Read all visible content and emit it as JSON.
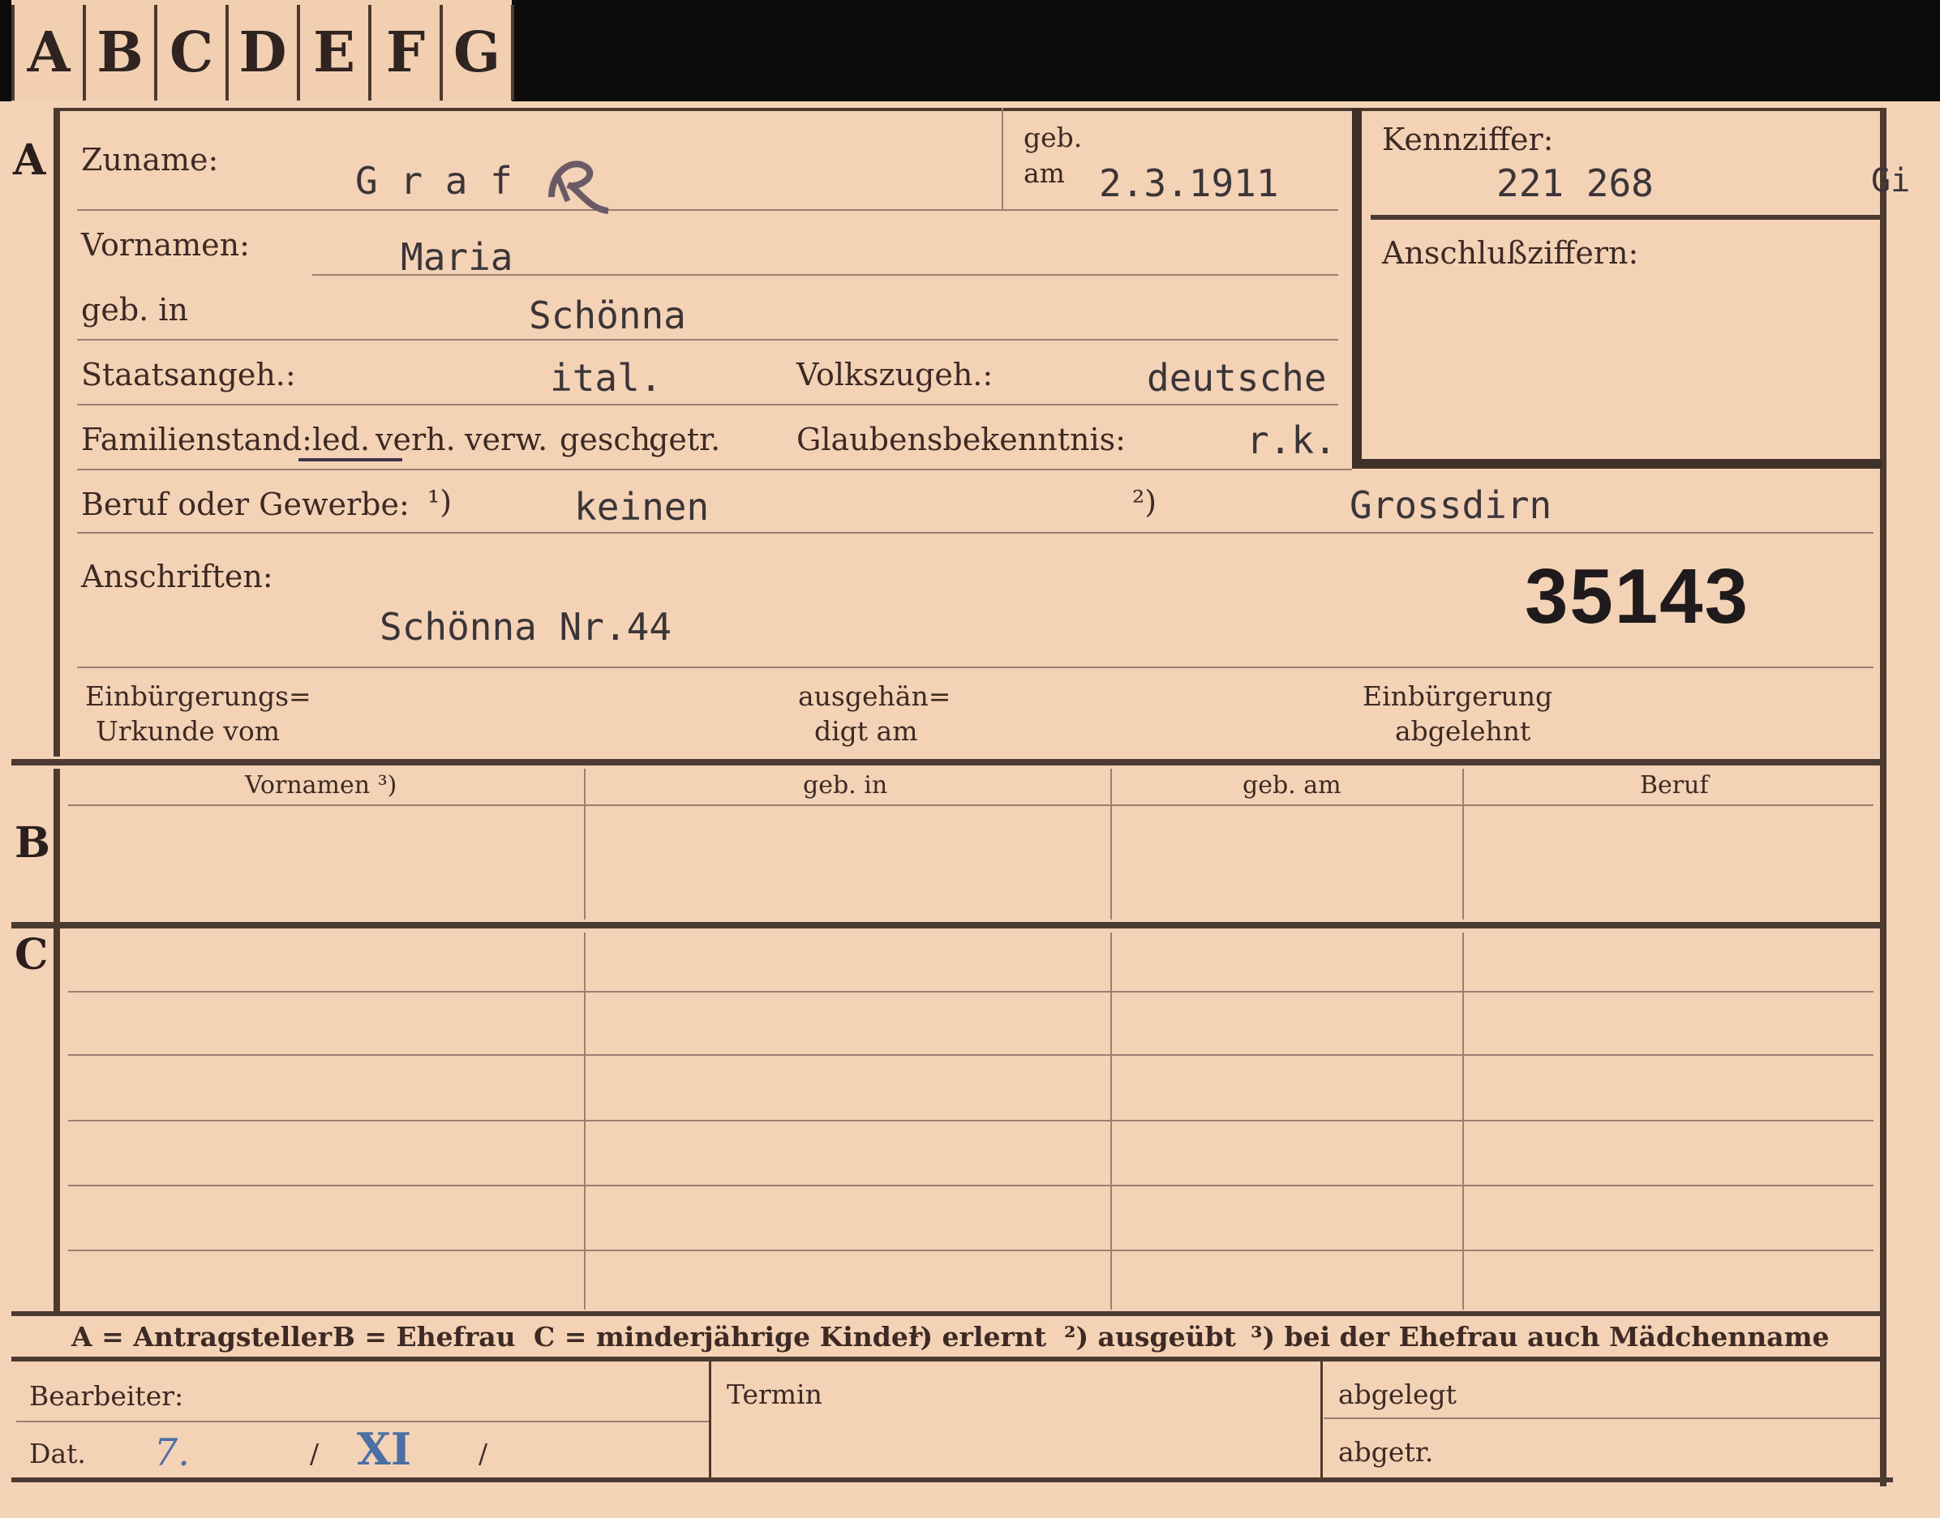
{
  "tabs": [
    "A",
    "B",
    "C",
    "D",
    "E",
    "F",
    "G"
  ],
  "sections": {
    "a": "A",
    "b": "B",
    "c": "C"
  },
  "applicant": {
    "surname_label": "Zuname:",
    "surname": "G r a f",
    "born_label1": "geb.",
    "born_label2": "am",
    "birth_date": "2.3.1911",
    "firstname_label": "Vornamen:",
    "firstname": "Maria",
    "birthplace_label": "geb. in",
    "birthplace": "Schönna",
    "citizenship_label": "Staatsangeh.:",
    "citizenship": "ital.",
    "ethnicity_label": "Volkszugeh.:",
    "ethnicity": "deutsche",
    "marital_label": "Familienstand:",
    "marital_options": [
      "led.",
      "verh.",
      "verw.",
      "gesch.",
      "getr."
    ],
    "marital_selected": "led.",
    "religion_label": "Glaubensbekenntnis:",
    "religion": "r.k.",
    "job_label": "Beruf oder Gewerbe:",
    "fn1": "¹)",
    "job_learned": "keinen",
    "fn2": "²)",
    "job_practised": "Grossdirn",
    "address_label": "Anschriften:",
    "address": "Schönna Nr.44",
    "case_number": "35143",
    "natur_cert_label1": "Einbürgerungs=",
    "natur_cert_label2": "Urkunde vom",
    "handed_label1": "ausgehän=",
    "handed_label2": "digt am",
    "natur_denied_label1": "Einbürgerung",
    "natur_denied_label2": "abgelehnt"
  },
  "reference": {
    "label": "Kennziffer:",
    "value": "221 268",
    "side_mark": "Gi",
    "connection_label": "Anschlußziffern:"
  },
  "family_table": {
    "headers": [
      "Vornamen ³)",
      "geb. in",
      "geb. am",
      "Beruf"
    ]
  },
  "legend": [
    "A = Antragsteller",
    "B = Ehefrau",
    "C = minderjährige Kinder",
    "¹) erlernt",
    "²) ausgeübt",
    "³) bei der Ehefrau auch Mädchenname"
  ],
  "footer": {
    "processor_label": "Bearbeiter:",
    "date_label": "Dat.",
    "date_day": "7.",
    "date_sep1": "/",
    "date_month": "XI",
    "date_sep2": "/",
    "deadline_label": "Termin",
    "filed_label": "abgelegt",
    "separated_label": "abgetr."
  }
}
